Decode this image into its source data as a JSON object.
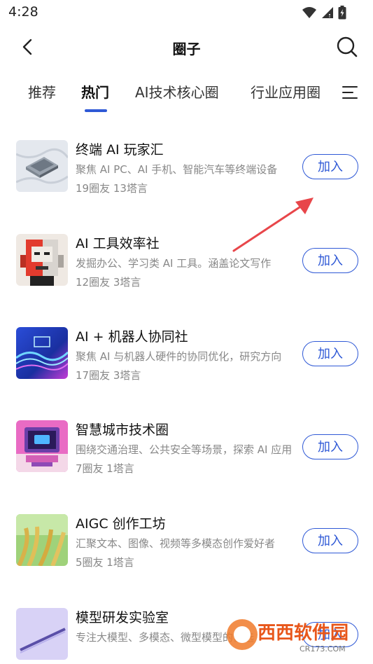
{
  "status": {
    "time": "4:28"
  },
  "nav": {
    "title": "圈子"
  },
  "tabs": [
    {
      "label": "推荐"
    },
    {
      "label": "热门"
    },
    {
      "label": "AI技术核心圈"
    },
    {
      "label": "行业应用圈"
    }
  ],
  "items": [
    {
      "name": "终端 AI 玩家汇",
      "desc": "聚焦 AI PC、AI 手机、智能汽车等终端设备",
      "stats": "19圈友 13塔言",
      "join": "加入"
    },
    {
      "name": "AI 工具效率社",
      "desc": "发掘办公、学习类 AI 工具。涵盖论文写作",
      "stats": "12圈友 3塔言",
      "join": "加入"
    },
    {
      "name": "AI + 机器人协同社",
      "desc": "聚焦 AI 与机器人硬件的协同优化，研究方向",
      "stats": "17圈友 3塔言",
      "join": "加入"
    },
    {
      "name": "智慧城市技术圈",
      "desc": "围绕交通治理、公共安全等场景，探索 AI 应用",
      "stats": "7圈友 1塔言",
      "join": "加入"
    },
    {
      "name": "AIGC 创作工坊",
      "desc": "汇聚文本、图像、视频等多模态创作爱好者",
      "stats": "5圈友 1塔言",
      "join": "加入"
    },
    {
      "name": "模型研发实验室",
      "desc": "专注大模型、多模态、微型模型的优选",
      "stats": "",
      "join": "加入"
    }
  ],
  "watermark": {
    "brand": "西西软件园",
    "site": "CR173.COM"
  },
  "colors": {
    "accent": "#2f59d6",
    "arrow": "#e8464a"
  }
}
